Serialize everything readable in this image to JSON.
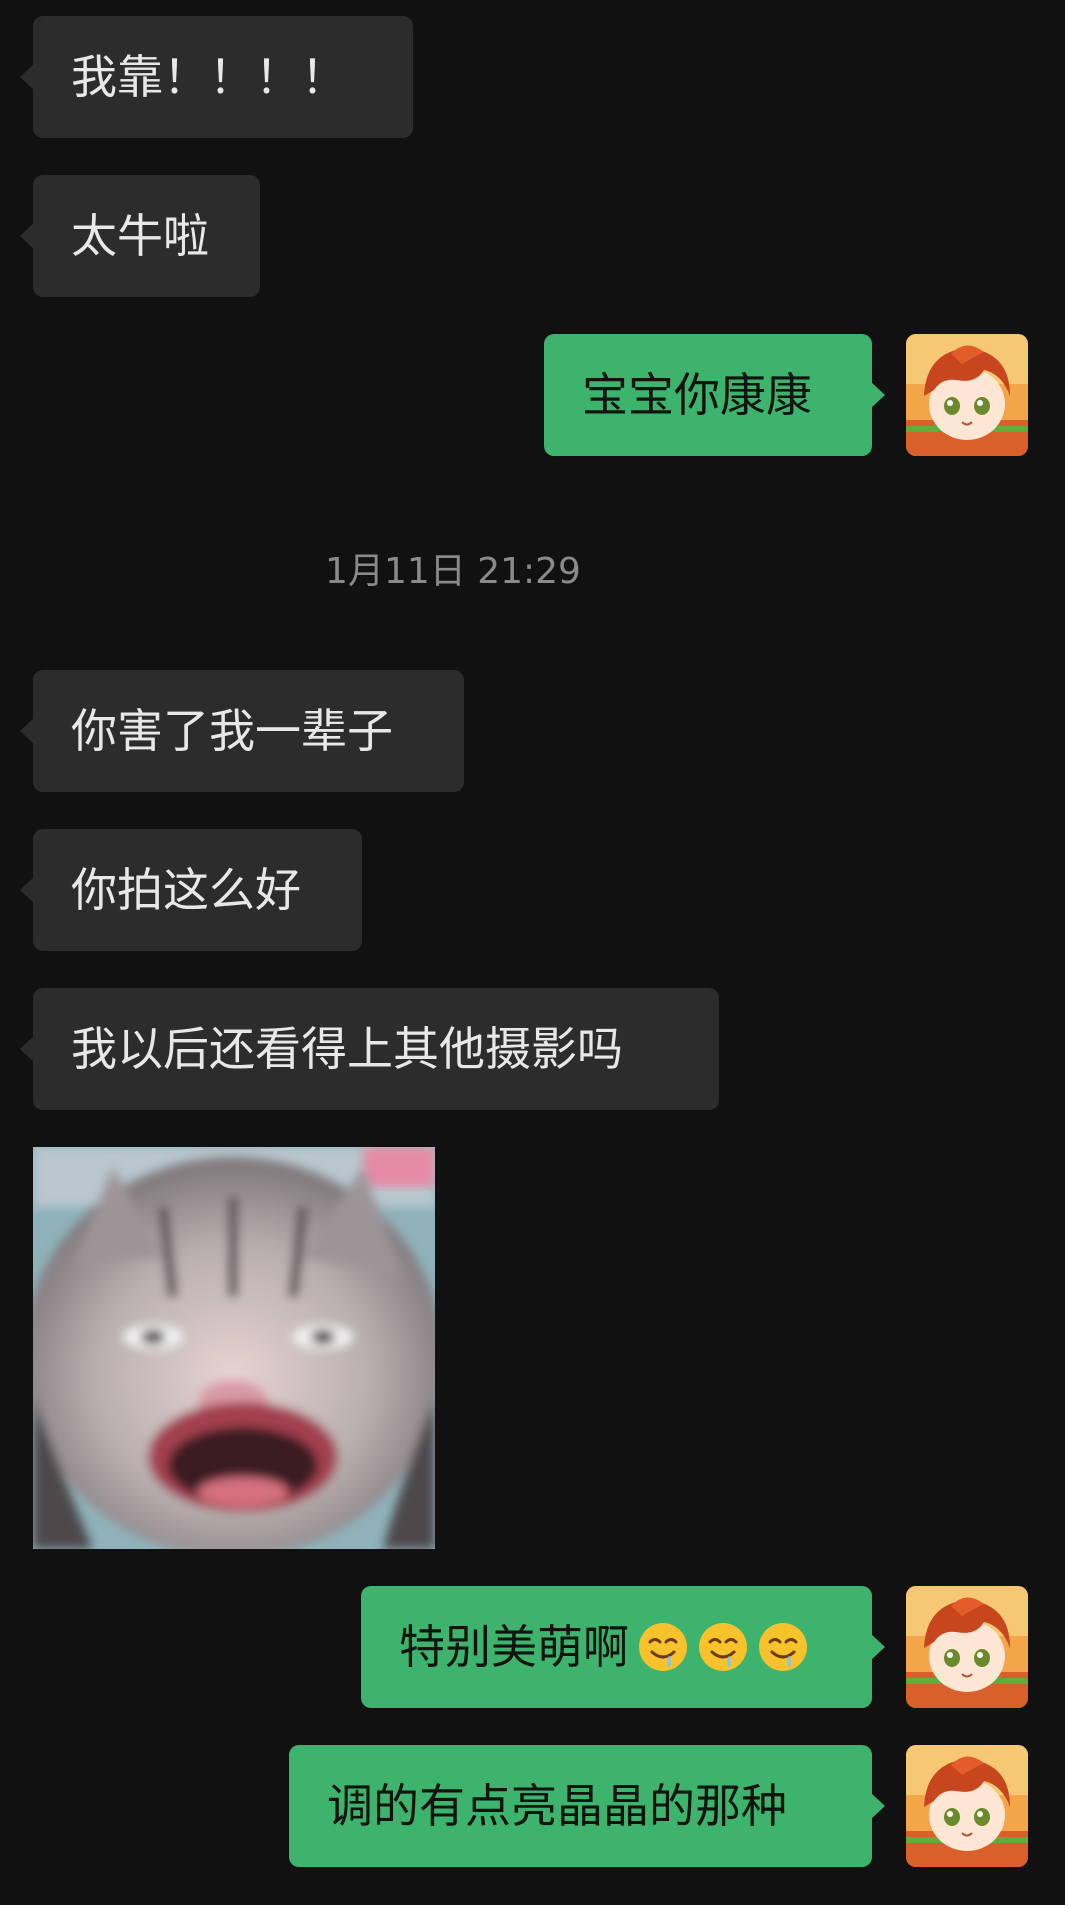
{
  "messages": [
    {
      "side": "in",
      "text": "我靠！！！！"
    },
    {
      "side": "in",
      "text": "太牛啦"
    },
    {
      "side": "out",
      "text": "宝宝你康康"
    },
    {
      "side": "in",
      "text": "你害了我一辈子"
    },
    {
      "side": "in",
      "text": "你拍这么好"
    },
    {
      "side": "in",
      "text": "我以后还看得上其他摄影吗"
    },
    {
      "side": "out",
      "text": "特别美萌啊"
    },
    {
      "side": "out",
      "text": "调的有点亮晶晶的那种"
    }
  ],
  "timestamp": "1月11日 21:29",
  "emojis": [
    "drooling-face-icon",
    "drooling-face-icon",
    "drooling-face-icon"
  ],
  "sticker": {
    "icon": "screaming-cat-sticker"
  },
  "avatar": {
    "icon": "anime-girl-avatar-icon"
  },
  "colors": {
    "background": "#111111",
    "incoming_bubble": "#2c2c2c",
    "outgoing_bubble": "#3db36d",
    "timestamp": "#8a8a8a"
  }
}
